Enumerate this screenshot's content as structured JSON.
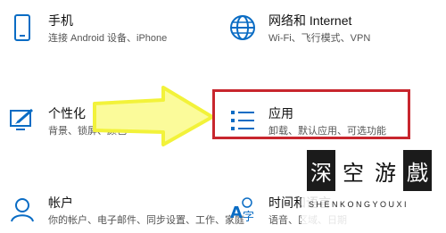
{
  "settings": {
    "phone": {
      "title": "手机",
      "desc": "连接 Android 设备、iPhone",
      "icon": "phone-icon"
    },
    "network": {
      "title": "网络和 Internet",
      "desc": "Wi-Fi、飞行模式、VPN",
      "icon": "globe-icon"
    },
    "personalization": {
      "title": "个性化",
      "desc": "背景、锁屏、颜色",
      "icon": "personalization-icon"
    },
    "apps": {
      "title": "应用",
      "desc": "卸载、默认应用、可选功能",
      "icon": "apps-list-icon"
    },
    "accounts": {
      "title": "帐户",
      "desc": "你的帐户、电子邮件、同步设置、工作、家庭",
      "icon": "person-icon"
    },
    "time": {
      "title": "时间和语言",
      "desc": "语音、区域、日期",
      "icon": "language-time-icon"
    }
  },
  "annotation": {
    "highlight_color": "#c8262e",
    "arrow_color": "#f2f23a"
  },
  "watermark": {
    "chars": [
      "深",
      "空",
      "游",
      "戲"
    ],
    "subtitle": "SHENKONGYOUXI"
  },
  "colors": {
    "accent": "#0a6cc4"
  }
}
